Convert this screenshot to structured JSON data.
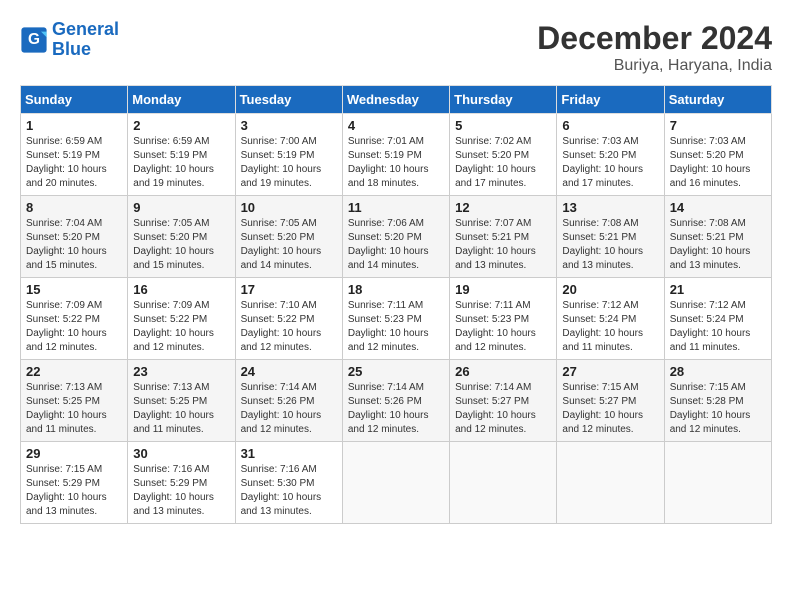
{
  "header": {
    "logo_line1": "General",
    "logo_line2": "Blue",
    "month": "December 2024",
    "location": "Buriya, Haryana, India"
  },
  "weekdays": [
    "Sunday",
    "Monday",
    "Tuesday",
    "Wednesday",
    "Thursday",
    "Friday",
    "Saturday"
  ],
  "weeks": [
    [
      {
        "day": "1",
        "sunrise": "6:59 AM",
        "sunset": "5:19 PM",
        "daylight": "10 hours and 20 minutes."
      },
      {
        "day": "2",
        "sunrise": "6:59 AM",
        "sunset": "5:19 PM",
        "daylight": "10 hours and 19 minutes."
      },
      {
        "day": "3",
        "sunrise": "7:00 AM",
        "sunset": "5:19 PM",
        "daylight": "10 hours and 19 minutes."
      },
      {
        "day": "4",
        "sunrise": "7:01 AM",
        "sunset": "5:19 PM",
        "daylight": "10 hours and 18 minutes."
      },
      {
        "day": "5",
        "sunrise": "7:02 AM",
        "sunset": "5:20 PM",
        "daylight": "10 hours and 17 minutes."
      },
      {
        "day": "6",
        "sunrise": "7:03 AM",
        "sunset": "5:20 PM",
        "daylight": "10 hours and 17 minutes."
      },
      {
        "day": "7",
        "sunrise": "7:03 AM",
        "sunset": "5:20 PM",
        "daylight": "10 hours and 16 minutes."
      }
    ],
    [
      {
        "day": "8",
        "sunrise": "7:04 AM",
        "sunset": "5:20 PM",
        "daylight": "10 hours and 15 minutes."
      },
      {
        "day": "9",
        "sunrise": "7:05 AM",
        "sunset": "5:20 PM",
        "daylight": "10 hours and 15 minutes."
      },
      {
        "day": "10",
        "sunrise": "7:05 AM",
        "sunset": "5:20 PM",
        "daylight": "10 hours and 14 minutes."
      },
      {
        "day": "11",
        "sunrise": "7:06 AM",
        "sunset": "5:20 PM",
        "daylight": "10 hours and 14 minutes."
      },
      {
        "day": "12",
        "sunrise": "7:07 AM",
        "sunset": "5:21 PM",
        "daylight": "10 hours and 13 minutes."
      },
      {
        "day": "13",
        "sunrise": "7:08 AM",
        "sunset": "5:21 PM",
        "daylight": "10 hours and 13 minutes."
      },
      {
        "day": "14",
        "sunrise": "7:08 AM",
        "sunset": "5:21 PM",
        "daylight": "10 hours and 13 minutes."
      }
    ],
    [
      {
        "day": "15",
        "sunrise": "7:09 AM",
        "sunset": "5:22 PM",
        "daylight": "10 hours and 12 minutes."
      },
      {
        "day": "16",
        "sunrise": "7:09 AM",
        "sunset": "5:22 PM",
        "daylight": "10 hours and 12 minutes."
      },
      {
        "day": "17",
        "sunrise": "7:10 AM",
        "sunset": "5:22 PM",
        "daylight": "10 hours and 12 minutes."
      },
      {
        "day": "18",
        "sunrise": "7:11 AM",
        "sunset": "5:23 PM",
        "daylight": "10 hours and 12 minutes."
      },
      {
        "day": "19",
        "sunrise": "7:11 AM",
        "sunset": "5:23 PM",
        "daylight": "10 hours and 12 minutes."
      },
      {
        "day": "20",
        "sunrise": "7:12 AM",
        "sunset": "5:24 PM",
        "daylight": "10 hours and 11 minutes."
      },
      {
        "day": "21",
        "sunrise": "7:12 AM",
        "sunset": "5:24 PM",
        "daylight": "10 hours and 11 minutes."
      }
    ],
    [
      {
        "day": "22",
        "sunrise": "7:13 AM",
        "sunset": "5:25 PM",
        "daylight": "10 hours and 11 minutes."
      },
      {
        "day": "23",
        "sunrise": "7:13 AM",
        "sunset": "5:25 PM",
        "daylight": "10 hours and 11 minutes."
      },
      {
        "day": "24",
        "sunrise": "7:14 AM",
        "sunset": "5:26 PM",
        "daylight": "10 hours and 12 minutes."
      },
      {
        "day": "25",
        "sunrise": "7:14 AM",
        "sunset": "5:26 PM",
        "daylight": "10 hours and 12 minutes."
      },
      {
        "day": "26",
        "sunrise": "7:14 AM",
        "sunset": "5:27 PM",
        "daylight": "10 hours and 12 minutes."
      },
      {
        "day": "27",
        "sunrise": "7:15 AM",
        "sunset": "5:27 PM",
        "daylight": "10 hours and 12 minutes."
      },
      {
        "day": "28",
        "sunrise": "7:15 AM",
        "sunset": "5:28 PM",
        "daylight": "10 hours and 12 minutes."
      }
    ],
    [
      {
        "day": "29",
        "sunrise": "7:15 AM",
        "sunset": "5:29 PM",
        "daylight": "10 hours and 13 minutes."
      },
      {
        "day": "30",
        "sunrise": "7:16 AM",
        "sunset": "5:29 PM",
        "daylight": "10 hours and 13 minutes."
      },
      {
        "day": "31",
        "sunrise": "7:16 AM",
        "sunset": "5:30 PM",
        "daylight": "10 hours and 13 minutes."
      },
      null,
      null,
      null,
      null
    ]
  ]
}
